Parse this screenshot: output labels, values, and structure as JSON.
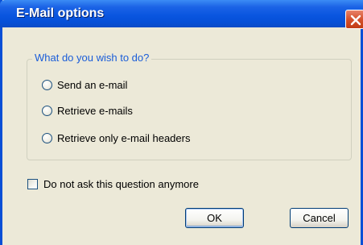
{
  "window": {
    "title": "E-Mail options"
  },
  "group": {
    "legend": "What do you wish to do?",
    "options": [
      {
        "label": "Send an e-mail",
        "selected": false
      },
      {
        "label": "Retrieve e-mails",
        "selected": false
      },
      {
        "label": "Retrieve only e-mail headers",
        "selected": false
      }
    ]
  },
  "checkbox": {
    "label": "Do not ask this question anymore",
    "checked": false
  },
  "buttons": {
    "ok_label": "OK",
    "cancel_label": "Cancel"
  },
  "colors": {
    "titlebar": "#0a56e0",
    "legend_text": "#1a5dd9",
    "close_button": "#d4502c",
    "dialog_background": "#ece9d8"
  },
  "icons": {
    "close": "close-icon"
  }
}
